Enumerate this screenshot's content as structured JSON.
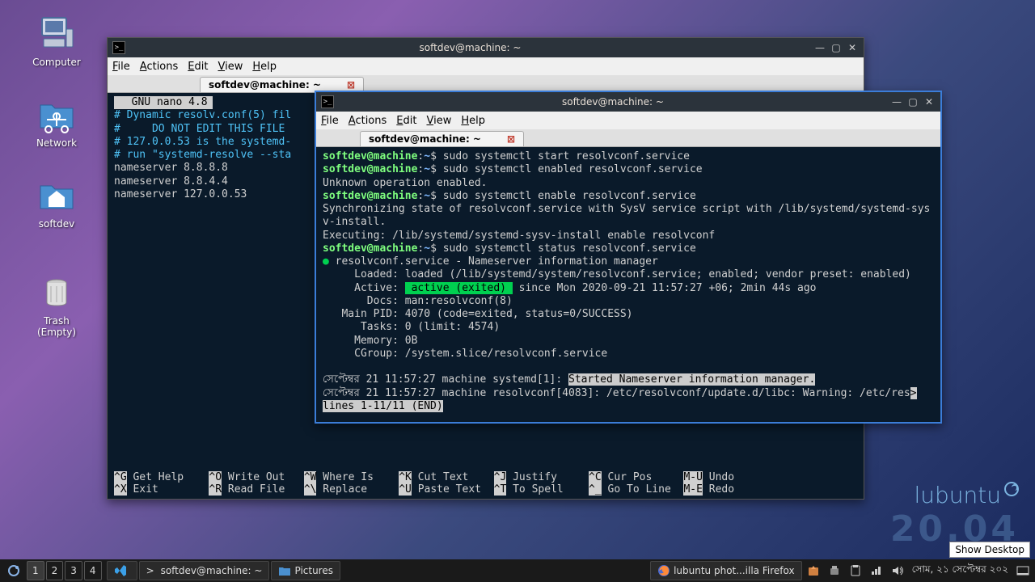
{
  "desktop": {
    "icons": [
      "Computer",
      "Network",
      "softdev",
      "Trash (Empty)"
    ]
  },
  "branding": {
    "name": "lubuntu",
    "version": "20.04"
  },
  "back_window": {
    "title": "softdev@machine: ~",
    "menubar": [
      "File",
      "Actions",
      "Edit",
      "View",
      "Help"
    ],
    "tab": "softdev@machine: ~",
    "nano": {
      "header": "  GNU nano 4.8",
      "lines": [
        "# Dynamic resolv.conf(5) fil",
        "#     DO NOT EDIT THIS FILE ",
        "# 127.0.0.53 is the systemd-",
        "# run \"systemd-resolve --sta",
        "nameserver 8.8.8.8",
        "nameserver 8.8.4.4",
        "nameserver 127.0.0.53"
      ],
      "footer_row1": [
        "^G",
        " Get Help    ",
        "^O",
        " Write Out   ",
        "^W",
        " Where Is    ",
        "^K",
        " Cut Text    ",
        "^J",
        " Justify     ",
        "^C",
        " Cur Pos     ",
        "M-U",
        " Undo"
      ],
      "footer_row2": [
        "^X",
        " Exit        ",
        "^R",
        " Read File   ",
        "^\\",
        " Replace     ",
        "^U",
        " Paste Text  ",
        "^T",
        " To Spell    ",
        "^_",
        " Go To Line  ",
        "M-E",
        " Redo"
      ]
    }
  },
  "front_window": {
    "title": "softdev@machine: ~",
    "menubar": [
      "File",
      "Actions",
      "Edit",
      "View",
      "Help"
    ],
    "tab": "softdev@machine: ~",
    "prompt_user": "softdev@machine",
    "prompt_path": "~",
    "lines": [
      {
        "type": "cmd",
        "text": "sudo systemctl start resolvconf.service"
      },
      {
        "type": "cmd",
        "text": "sudo systemctl enabled resolvconf.service"
      },
      {
        "type": "out",
        "text": "Unknown operation enabled."
      },
      {
        "type": "cmd",
        "text": "sudo systemctl enable resolvconf.service"
      },
      {
        "type": "out",
        "text": "Synchronizing state of resolvconf.service with SysV service script with /lib/systemd/systemd-sys"
      },
      {
        "type": "out",
        "text": "v-install."
      },
      {
        "type": "out",
        "text": "Executing: /lib/systemd/systemd-sysv-install enable resolvconf"
      },
      {
        "type": "cmd",
        "text": "sudo systemctl status resolvconf.service"
      }
    ],
    "status": {
      "header": "● resolvconf.service - Nameserver information manager",
      "loaded": "     Loaded: loaded (/lib/systemd/system/resolvconf.service; enabled; vendor preset: enabled)",
      "active_pre": "     Active: ",
      "active_hl": "active (exited)",
      "active_post": " since Mon 2020-09-21 11:57:27 +06; 2min 44s ago",
      "docs": "       Docs: man:resolvconf(8)",
      "mainpid": "   Main PID: 4070 (code=exited, status=0/SUCCESS)",
      "tasks": "      Tasks: 0 (limit: 4574)",
      "memory": "     Memory: 0B",
      "cgroup": "     CGroup: /system.slice/resolvconf.service"
    },
    "log1_pre": "সেপ্টেম্বর 21 11:57:27 machine systemd[1]: ",
    "log1_msg": "Started Nameserver information manager.",
    "log2": "সেপ্টেম্বর 21 11:57:27 machine resolvconf[4083]: /etc/resolvconf/update.d/libc: Warning: /etc/res",
    "pager": "lines 1-11/11 (END)"
  },
  "taskbar": {
    "workspaces": [
      "1",
      "2",
      "3",
      "4"
    ],
    "tasks": [
      {
        "icon": "code",
        "label": ""
      },
      {
        "icon": "term",
        "label": "softdev@machine: ~"
      },
      {
        "icon": "folder",
        "label": "Pictures"
      }
    ],
    "tasks_right": [
      {
        "icon": "firefox",
        "label": "lubuntu phot...illa Firefox"
      }
    ],
    "clock": "সোম, ২১ সেপ্টেম্বর ২০২",
    "show_desktop_tip": "Show Desktop"
  }
}
